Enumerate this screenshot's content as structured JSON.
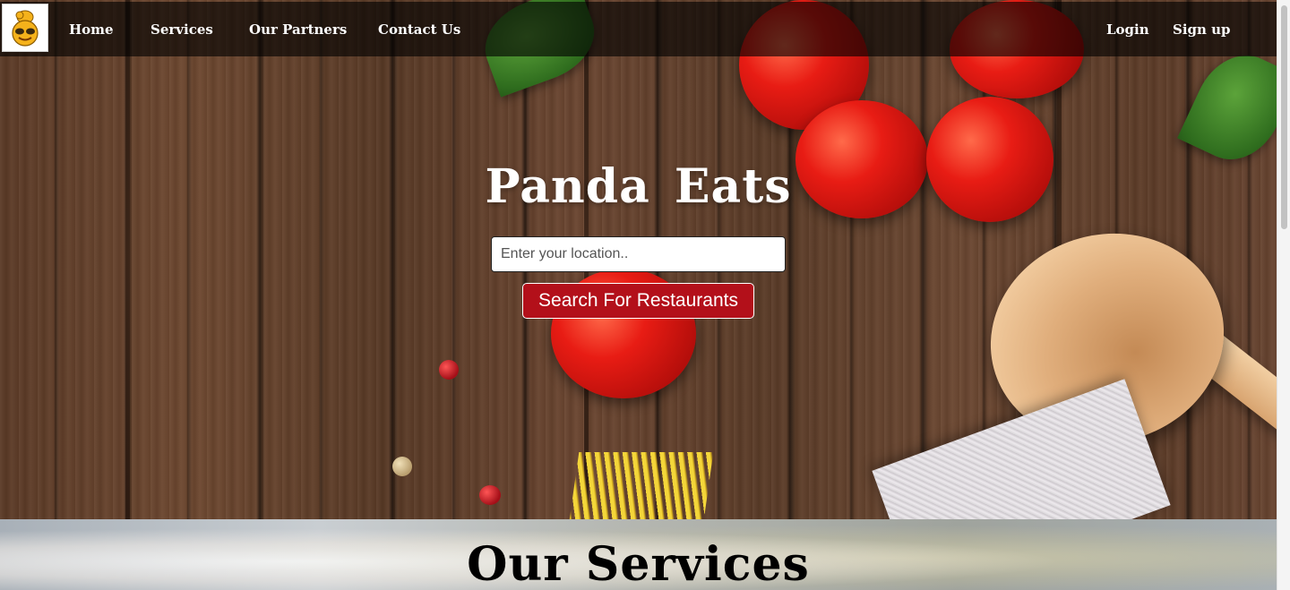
{
  "brand": {
    "logo_icon": "panda-chef-icon"
  },
  "nav": {
    "left": [
      {
        "label": "Home"
      },
      {
        "label": "Services"
      },
      {
        "label": "Our Partners"
      },
      {
        "label": "Contact Us"
      }
    ],
    "right": [
      {
        "label": "Login"
      },
      {
        "label": "Sign up"
      }
    ]
  },
  "hero": {
    "title": "Panda  Eats",
    "location_placeholder": "Enter your location..",
    "search_label": "Search For Restaurants"
  },
  "services": {
    "title": "Our Services"
  },
  "colors": {
    "navbar_bg": "rgba(0,0,0,0.62)",
    "button_red": "#b3101a",
    "text_white": "#ffffff"
  }
}
